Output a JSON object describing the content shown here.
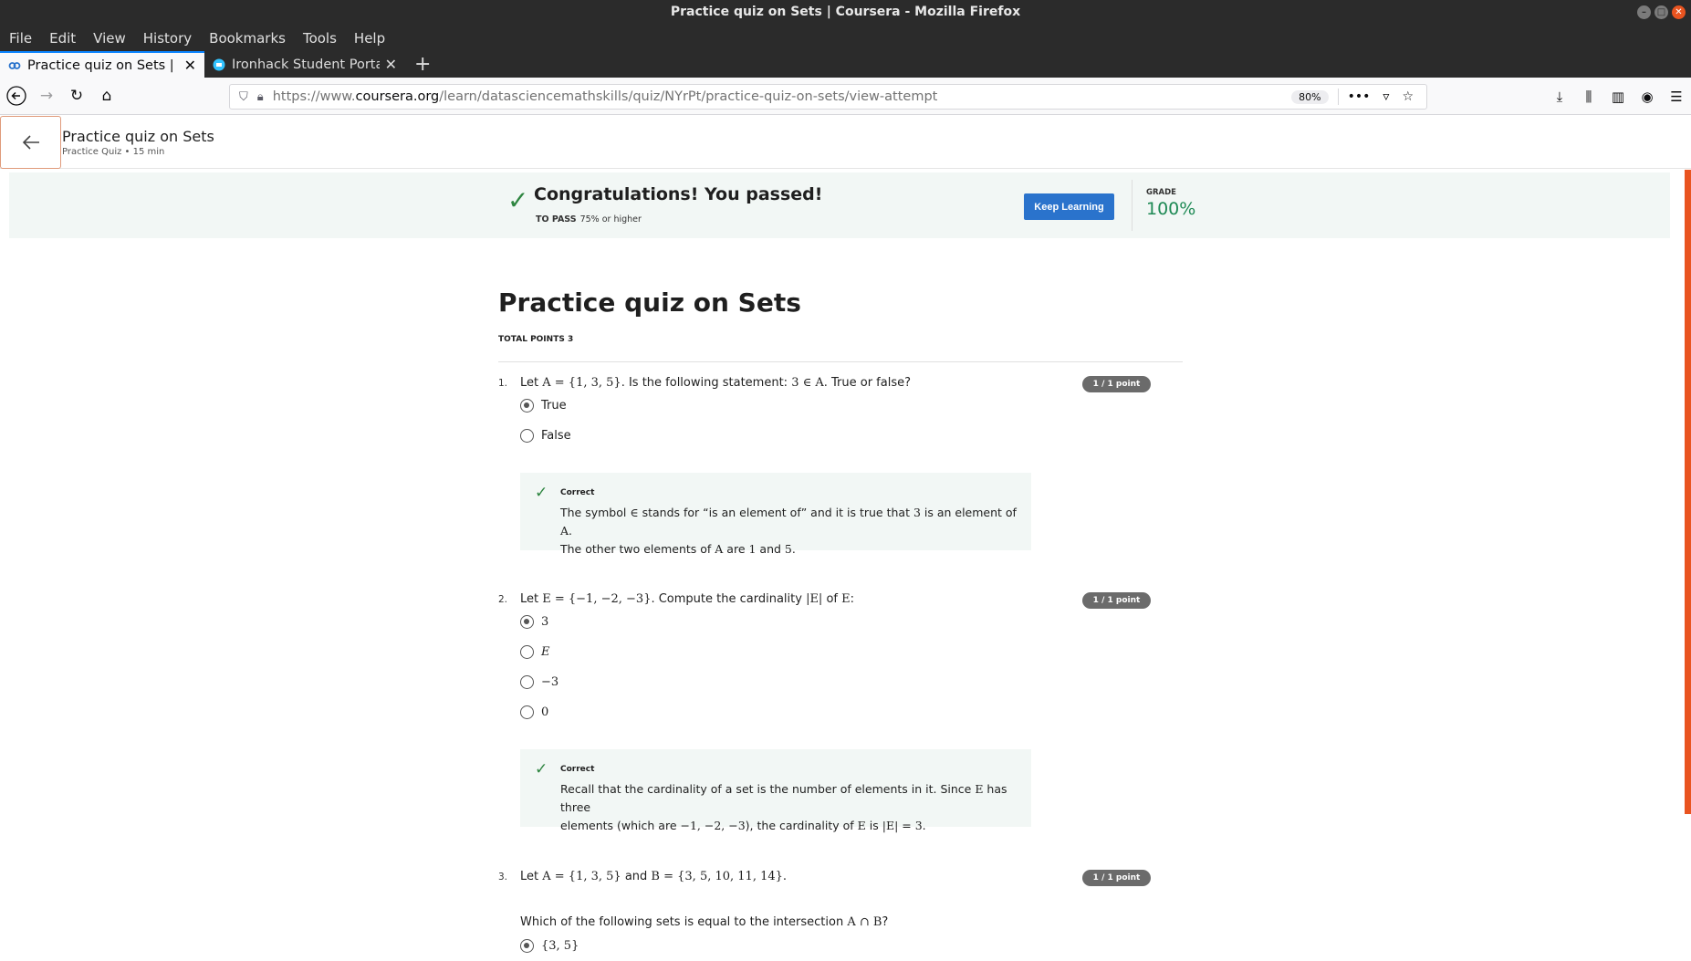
{
  "window": {
    "title": "Practice quiz on Sets | Coursera - Mozilla Firefox"
  },
  "menu": [
    "File",
    "Edit",
    "View",
    "History",
    "Bookmarks",
    "Tools",
    "Help"
  ],
  "tabs": [
    {
      "title": "Practice quiz on Sets | Coursera",
      "active": true
    },
    {
      "title": "Ironhack Student Portal",
      "active": false
    }
  ],
  "address": {
    "prefix": "https://www.",
    "domain": "coursera.org",
    "path": "/learn/datasciencemathskills/quiz/NYrPt/practice-quiz-on-sets/view-attempt",
    "zoom": "80%"
  },
  "header": {
    "title": "Practice quiz on Sets",
    "subtitle": "Practice Quiz • 15 min"
  },
  "result": {
    "message": "Congratulations! You passed!",
    "to_pass_label": "TO PASS",
    "to_pass_value": "75% or higher",
    "button": "Keep Learning",
    "grade_label": "GRADE",
    "grade_value": "100%"
  },
  "quiz": {
    "title": "Practice quiz on Sets",
    "total_points": "TOTAL POINTS 3",
    "questions": [
      {
        "number": "1.",
        "prompt_parts": [
          "Let ",
          "A = {1, 3, 5}",
          ". Is the following statement: ",
          "3 ∈ A",
          ". True or false?"
        ],
        "points": "1 / 1 point",
        "options": [
          {
            "label": "True",
            "selected": true
          },
          {
            "label": "False",
            "selected": false
          }
        ],
        "feedback_label": "Correct",
        "feedback_line1": [
          "The symbol ",
          "∈",
          " stands for “is an element of” and it is true that ",
          "3",
          " is an element of ",
          "A",
          "."
        ],
        "feedback_line2": [
          "The other two elements of ",
          "A",
          " are ",
          "1",
          " and ",
          "5",
          "."
        ]
      },
      {
        "number": "2.",
        "prompt_parts": [
          "Let ",
          "E = {−1, −2, −3}",
          ". Compute the cardinality ",
          "|E|",
          " of ",
          "E",
          ":"
        ],
        "points": "1 / 1 point",
        "options": [
          {
            "label": "3",
            "selected": true
          },
          {
            "label": "E",
            "selected": false
          },
          {
            "label": "−3",
            "selected": false
          },
          {
            "label": "0",
            "selected": false
          }
        ],
        "feedback_label": "Correct",
        "feedback_line1": [
          "Recall that the cardinality of a set is the number of elements in it. Since ",
          "E",
          " has three"
        ],
        "feedback_line2": [
          "elements (which are ",
          "−1, −2, −3",
          "), the cardinality of ",
          "E",
          " is ",
          "|E| = 3",
          "."
        ]
      },
      {
        "number": "3.",
        "prompt_parts": [
          "Let ",
          "A = {1, 3, 5}",
          " and ",
          "B = {3, 5, 10, 11, 14}",
          "."
        ],
        "points": "1 / 1 point",
        "subprompt_parts": [
          "Which of the following sets is equal to the intersection ",
          "A ∩ B",
          "?"
        ],
        "options": [
          {
            "label": "{3, 5}",
            "selected": true
          }
        ]
      }
    ]
  }
}
